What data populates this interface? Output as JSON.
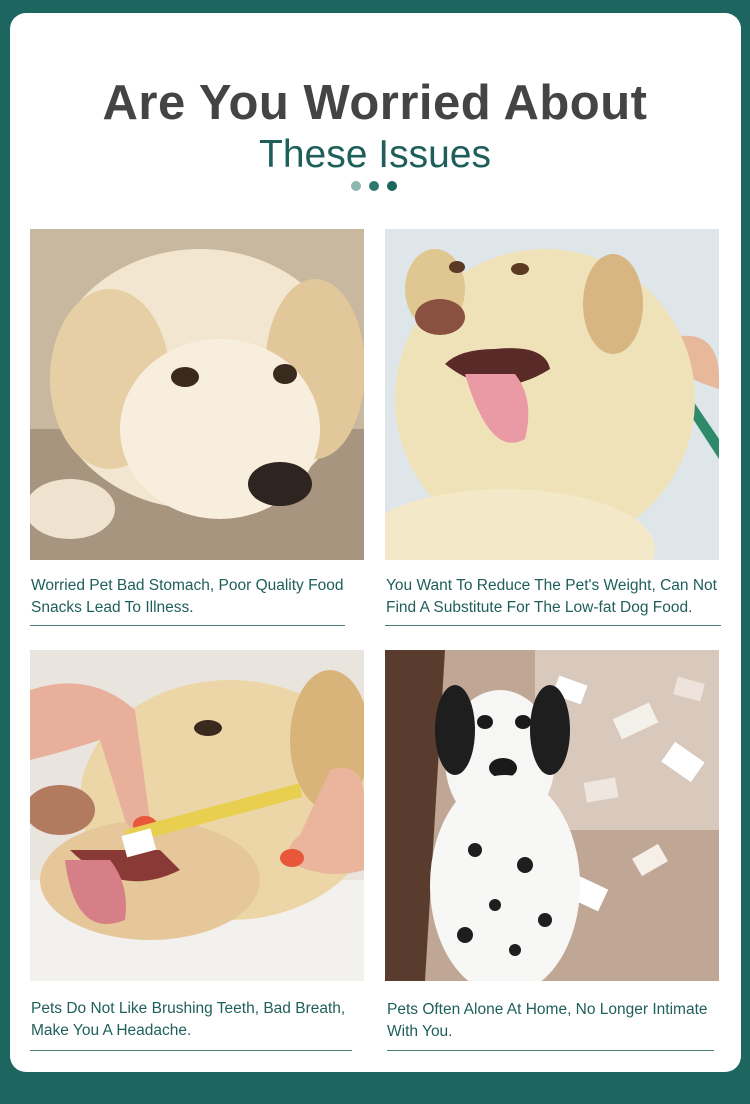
{
  "header": {
    "title": "Are You Worried About",
    "subtitle": "These Issues"
  },
  "colors": {
    "background": "#1d6660",
    "title": "#444444",
    "accent": "#1f5f5a",
    "dot_light": "#8fb6b2",
    "dot_mid": "#2f7872",
    "dot_dark": "#1d6660"
  },
  "issues": [
    {
      "caption": "Worried Pet Bad Stomach, Poor Quality Food Snacks Lead To Illness.",
      "image": "golden-retriever-lying-photo"
    },
    {
      "caption": "You Want To Reduce The Pet's Weight, Can Not Find A Substitute For The Low-fat Dog Food.",
      "image": "labrador-tongue-out-photo"
    },
    {
      "caption": "Pets Do Not Like Brushing Teeth, Bad Breath, Make You A Headache.",
      "image": "dog-teeth-brushing-photo"
    },
    {
      "caption": "Pets Often Alone At Home, No Longer Intimate With You.",
      "image": "dalmatian-torn-paper-photo"
    }
  ]
}
